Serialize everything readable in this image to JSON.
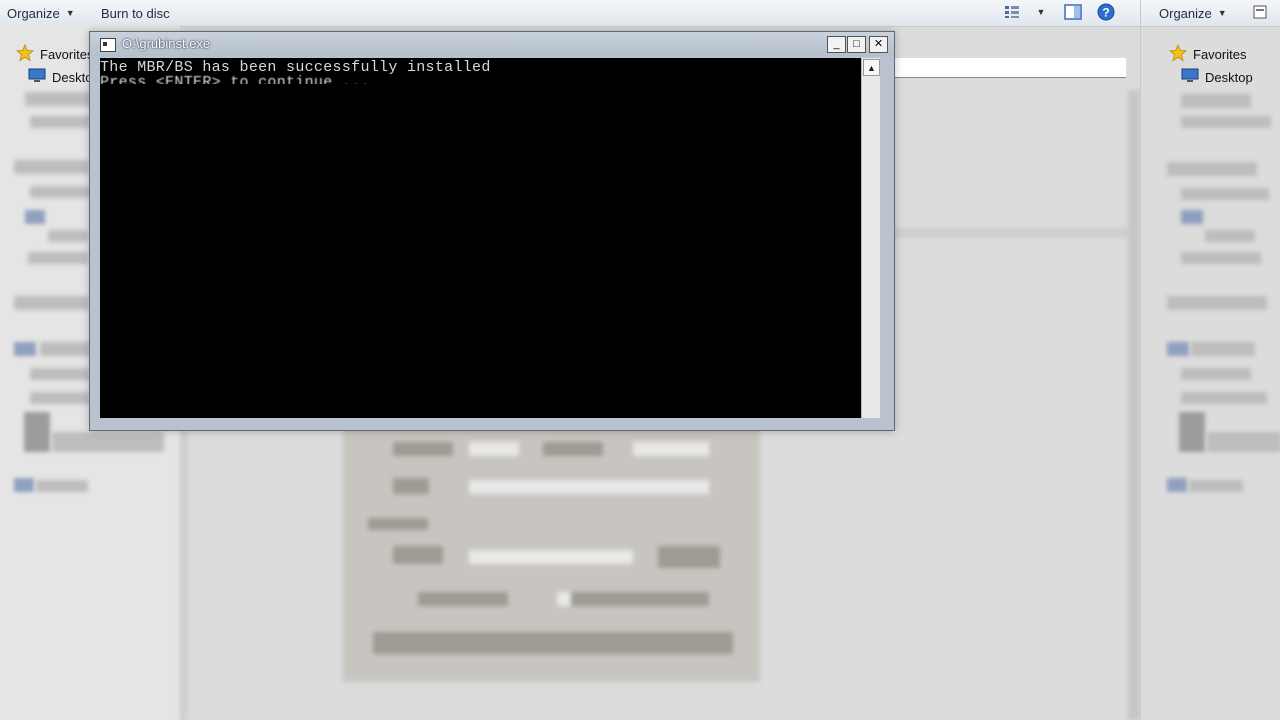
{
  "left_explorer": {
    "toolbar": {
      "organize": "Organize",
      "burn": "Burn to disc"
    },
    "nav": {
      "favorites": "Favorites",
      "desktop": "Desktop"
    }
  },
  "right_explorer": {
    "toolbar": {
      "organize": "Organize"
    },
    "nav": {
      "favorites": "Favorites",
      "desktop": "Desktop"
    }
  },
  "console": {
    "title": "O:\\grubinst.exe",
    "lines": [
      "The MBR/BS has been successfully installed",
      "Press <ENTER> to continue ..."
    ],
    "buttons": {
      "minimize": "_",
      "maximize": "□",
      "close": "✕"
    }
  },
  "icons": {
    "favorites": "star-icon",
    "desktop": "monitor-icon",
    "help": "help-icon",
    "views": "views-icon",
    "preview": "preview-pane-icon"
  }
}
